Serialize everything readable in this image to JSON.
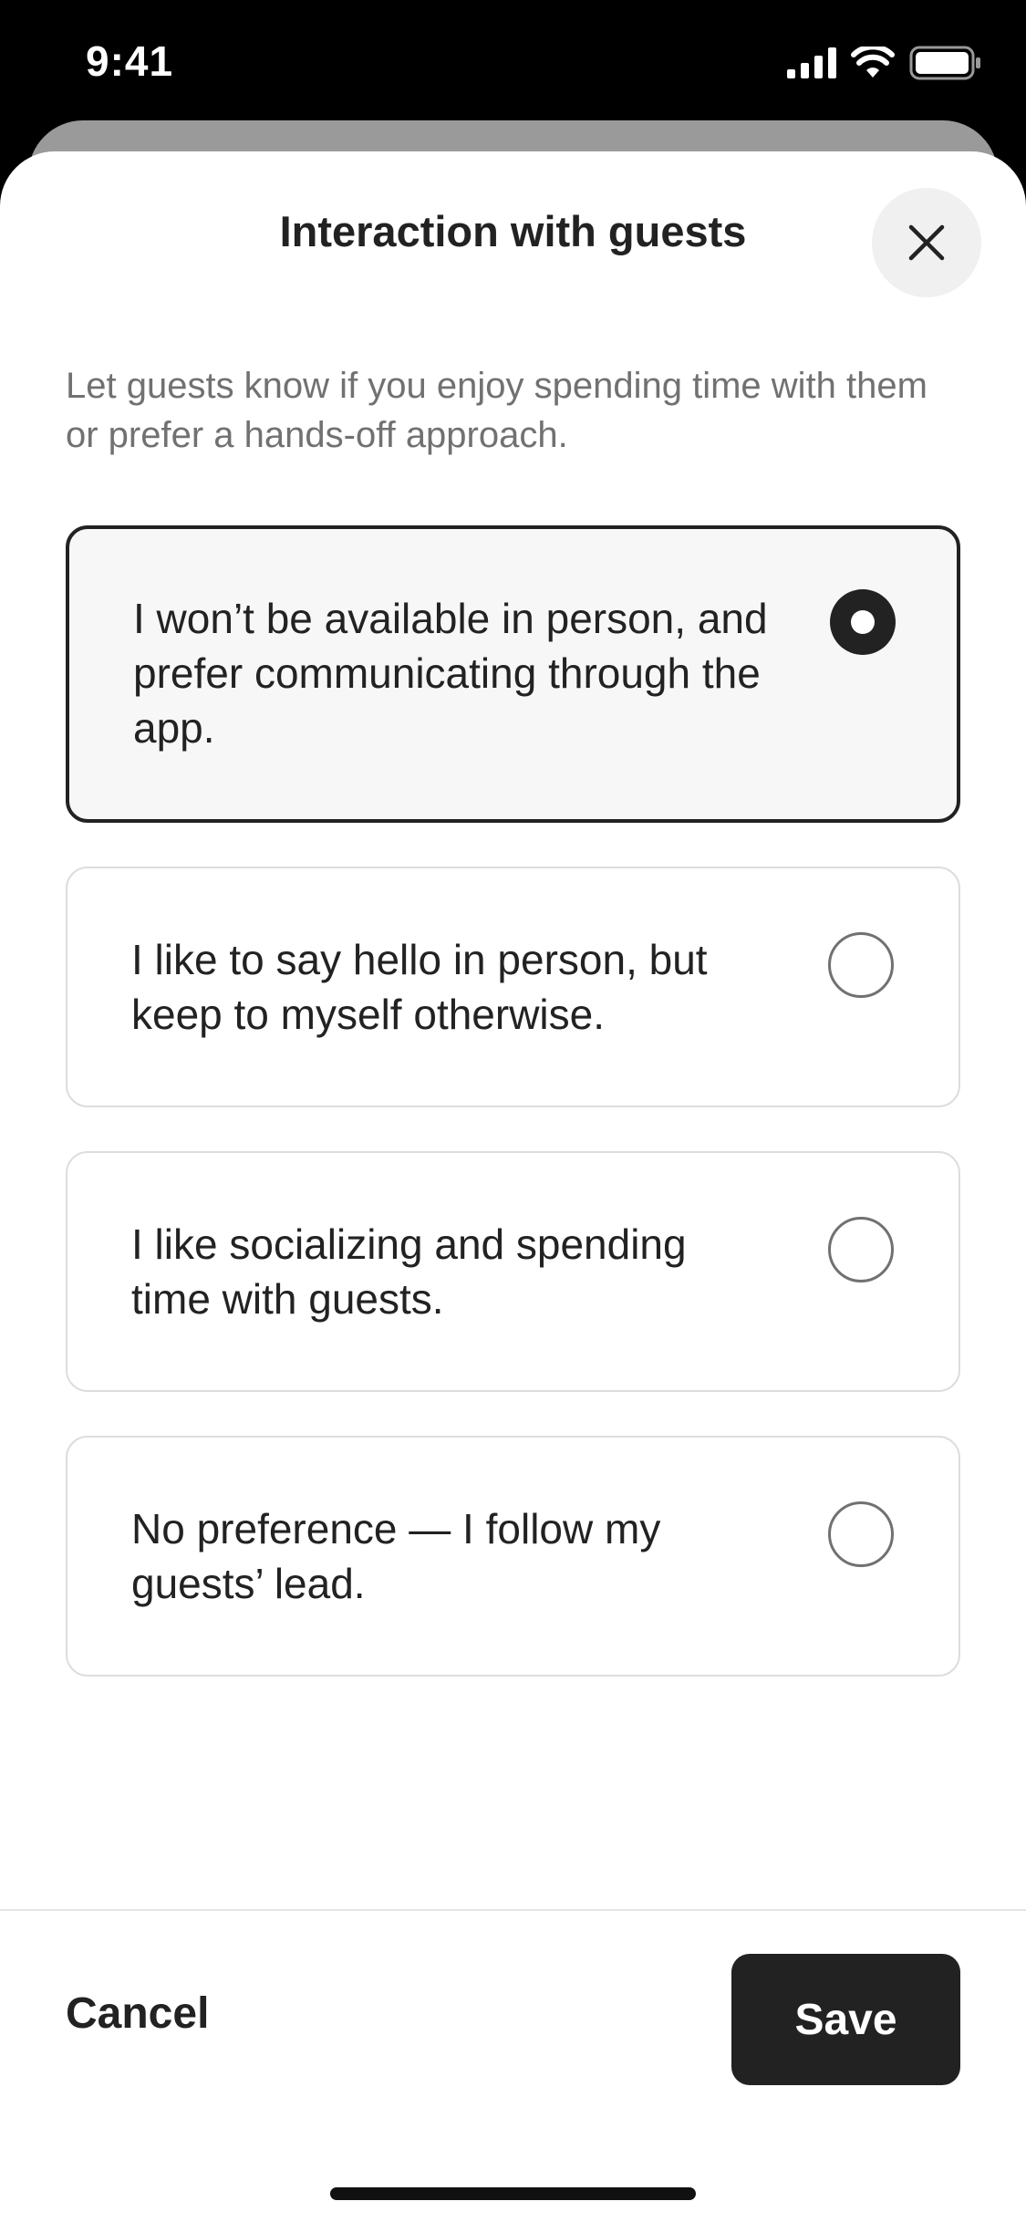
{
  "status_bar": {
    "time": "9:41"
  },
  "sheet": {
    "title": "Interaction with guests",
    "description": "Let guests know if you enjoy spending time with them or prefer a hands-off approach."
  },
  "options": [
    {
      "label": "I won’t be available in person, and prefer communicating through the app.",
      "selected": true
    },
    {
      "label": "I like to say hello in person, but keep to myself otherwise.",
      "selected": false
    },
    {
      "label": "I like socializing and spending time with guests.",
      "selected": false
    },
    {
      "label": "No preference — I follow my guests’ lead.",
      "selected": false
    }
  ],
  "footer": {
    "cancel_label": "Cancel",
    "save_label": "Save"
  },
  "icons": {
    "close": "close-icon",
    "signal": "cellular-signal-icon",
    "wifi": "wifi-icon",
    "battery": "battery-icon"
  },
  "colors": {
    "text_primary": "#222222",
    "text_secondary": "#717171",
    "border": "#dddddd",
    "selected_bg": "#f7f7f7",
    "button_dark": "#222222"
  }
}
